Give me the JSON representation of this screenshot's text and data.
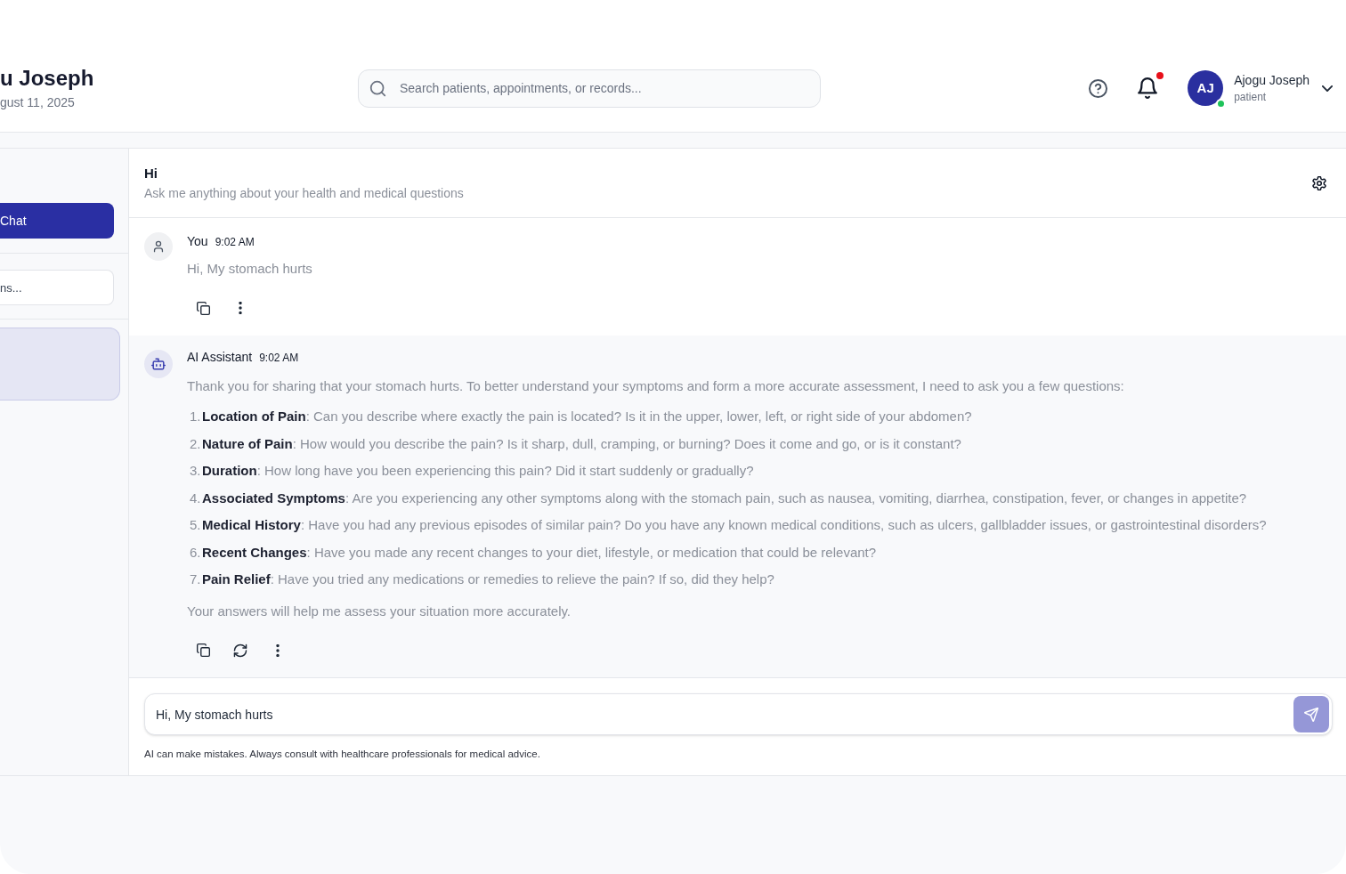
{
  "header": {
    "title": "u Joseph",
    "date": "gust 11, 2025",
    "search": {
      "placeholder": "Search patients, appointments, or records..."
    },
    "notifications": {
      "unread": true
    },
    "user": {
      "initials": "AJ",
      "name": "Ajogu Joseph",
      "role": "patient",
      "online": true
    }
  },
  "sidebar": {
    "new_chat_button": "Chat",
    "search": {
      "placeholder": "ns..."
    },
    "conversations": [
      {
        "selected": true
      }
    ]
  },
  "chat": {
    "title": "Hi",
    "subtitle": "Ask me anything about your health and medical questions",
    "messages": [
      {
        "kind": "user",
        "author": "You",
        "time": "9:02 AM",
        "content": [
          {
            "kind": "paragraph",
            "text": "Hi, My stomach hurts"
          }
        ],
        "actions": [
          {
            "kind": "copy"
          },
          {
            "kind": "more"
          }
        ]
      },
      {
        "kind": "assistant",
        "author": "AI Assistant",
        "time": "9:02 AM",
        "content": [
          {
            "kind": "paragraph",
            "text": "Thank you for sharing that your stomach hurts. To better understand your symptoms and form a more accurate assessment, I need to ask you a few questions:"
          },
          {
            "kind": "list",
            "items": [
              {
                "number": "1.",
                "text": "**Location of Pain**: Can you describe where exactly the pain is located? Is it in the upper, lower, left, or right side of your abdomen?"
              },
              {
                "number": "2.",
                "text": "**Nature of Pain**: How would you describe the pain? Is it sharp, dull, cramping, or burning? Does it come and go, or is it constant?"
              },
              {
                "number": "3.",
                "text": "**Duration**: How long have you been experiencing this pain? Did it start suddenly or gradually?"
              },
              {
                "number": "4.",
                "text": "**Associated Symptoms**: Are you experiencing any other symptoms along with the stomach pain, such as nausea, vomiting, diarrhea, constipation, fever, or changes in appetite?"
              },
              {
                "number": "5.",
                "text": "**Medical History**: Have you had any previous episodes of similar pain? Do you have any known medical conditions, such as ulcers, gallbladder issues, or gastrointestinal disorders?"
              },
              {
                "number": "6.",
                "text": "**Recent Changes**: Have you made any recent changes to your diet, lifestyle, or medication that could be relevant?"
              },
              {
                "number": "7.",
                "text": "**Pain Relief**: Have you tried any medications or remedies to relieve the pain? If so, did they help?"
              }
            ]
          },
          {
            "kind": "paragraph",
            "text": "Your answers will help me assess your situation more accurately."
          }
        ],
        "actions": [
          {
            "kind": "copy"
          },
          {
            "kind": "regenerate"
          },
          {
            "kind": "more"
          }
        ]
      }
    ],
    "composer": {
      "value": "Hi, My stomach hurts"
    },
    "disclaimer": "AI can make mistakes. Always consult with healthcare professionals for medical advice."
  }
}
